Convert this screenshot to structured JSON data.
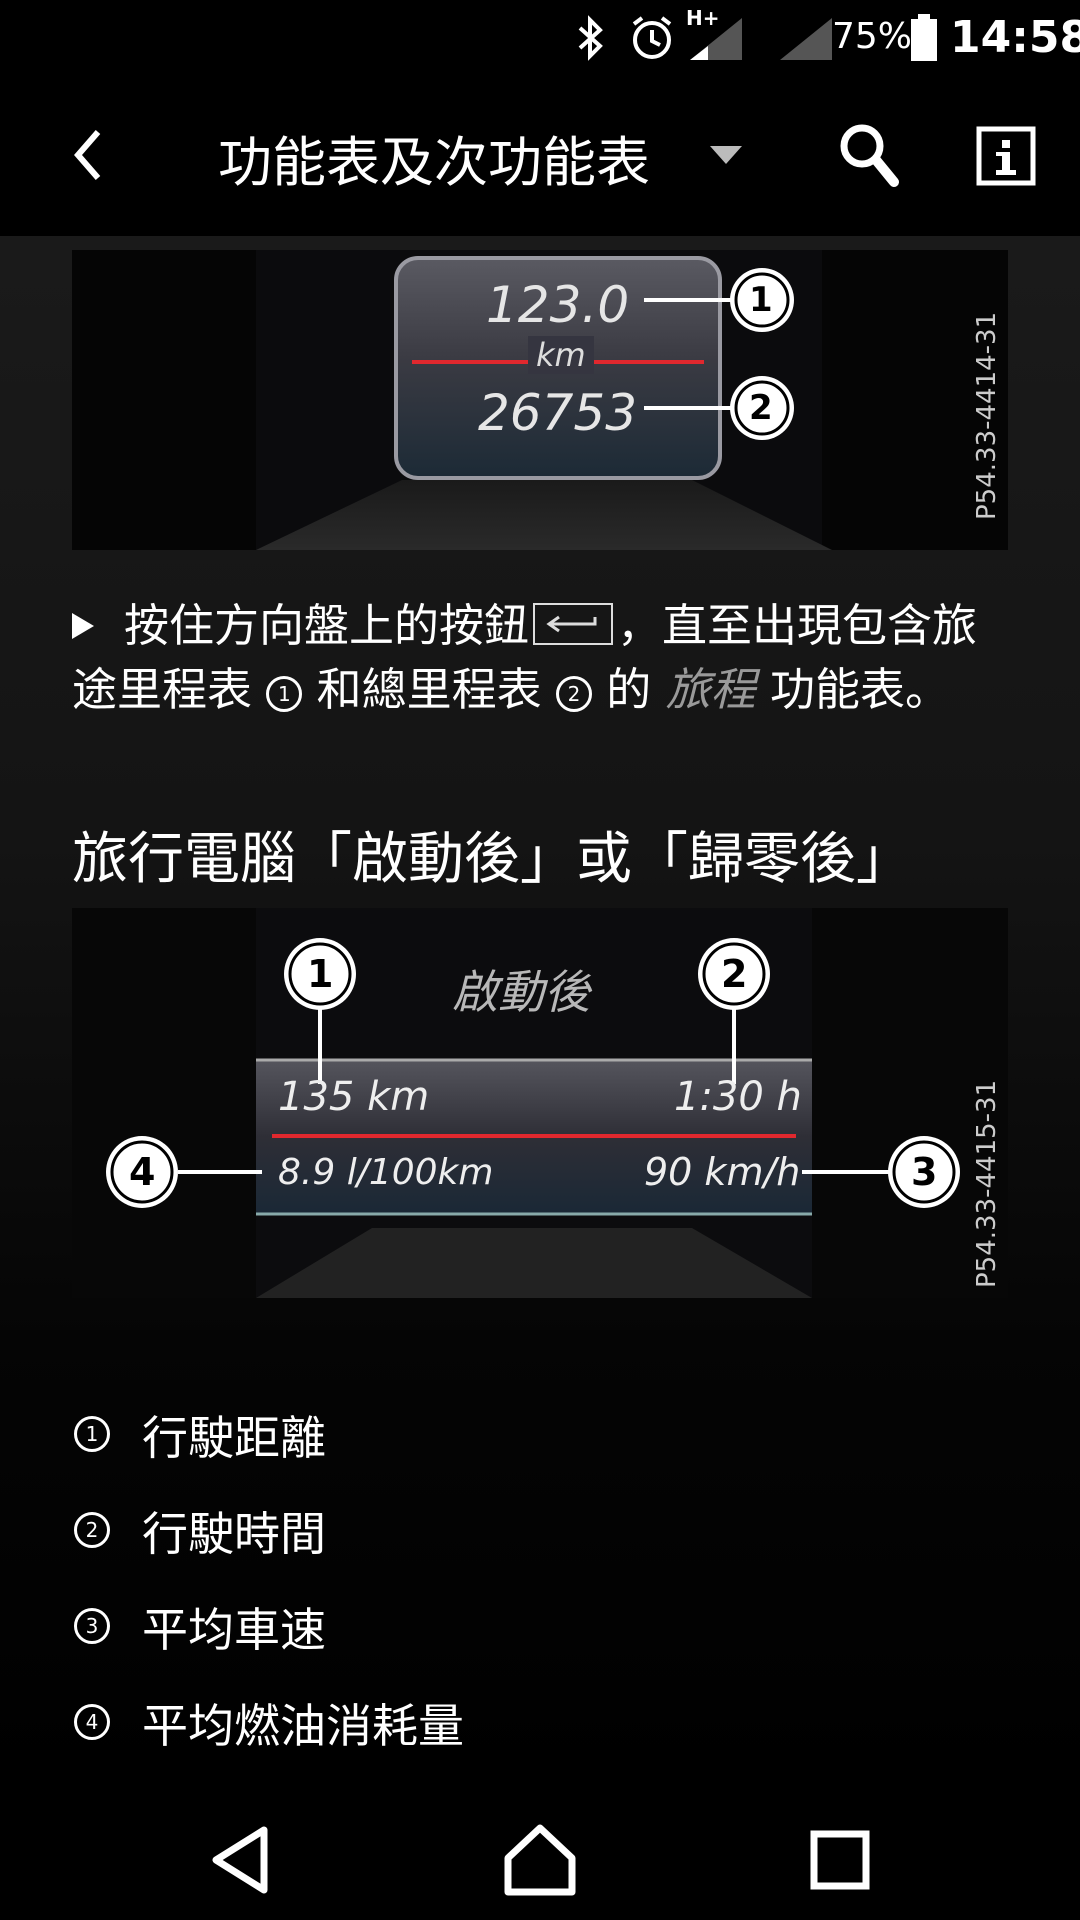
{
  "status_bar": {
    "battery_percent": "75%",
    "time": "14:58",
    "network_label": "H+",
    "icons": [
      "bluetooth-icon",
      "alarm-icon",
      "signal-icon",
      "signal-icon",
      "battery-icon"
    ]
  },
  "app_bar": {
    "title": "功能表及次功能表",
    "icons": [
      "back-chevron-icon",
      "dropdown-caret-icon",
      "search-icon",
      "info-icon"
    ]
  },
  "figure1": {
    "trip_value": "123.0",
    "unit": "km",
    "total_value": "26753",
    "callouts": [
      "1",
      "2"
    ],
    "code": "P54.33-4414-31"
  },
  "instruction": {
    "part1": "按住方向盤上的按鈕",
    "part2": "，直至出現包含旅途里程表",
    "marker1": "1",
    "part3": "和總里程表",
    "marker2": "2",
    "part4": "的",
    "italic_term": "旅程",
    "part5": "功能表。"
  },
  "section_heading": "旅行電腦「啟動後」或「歸零後」",
  "figure2": {
    "header": "啟動後",
    "distance": "135 km",
    "time": "1:30 h",
    "consumption": "8.9 l/100km",
    "speed": "90 km/h",
    "callouts": [
      "1",
      "2",
      "3",
      "4"
    ],
    "code": "P54.33-4415-31"
  },
  "legend": [
    {
      "num": "1",
      "label": "行駛距離"
    },
    {
      "num": "2",
      "label": "行駛時間"
    },
    {
      "num": "3",
      "label": "平均車速"
    },
    {
      "num": "4",
      "label": "平均燃油消耗量"
    }
  ],
  "nav_bar": {
    "icons": [
      "back-triangle-icon",
      "home-icon",
      "recents-icon"
    ]
  }
}
